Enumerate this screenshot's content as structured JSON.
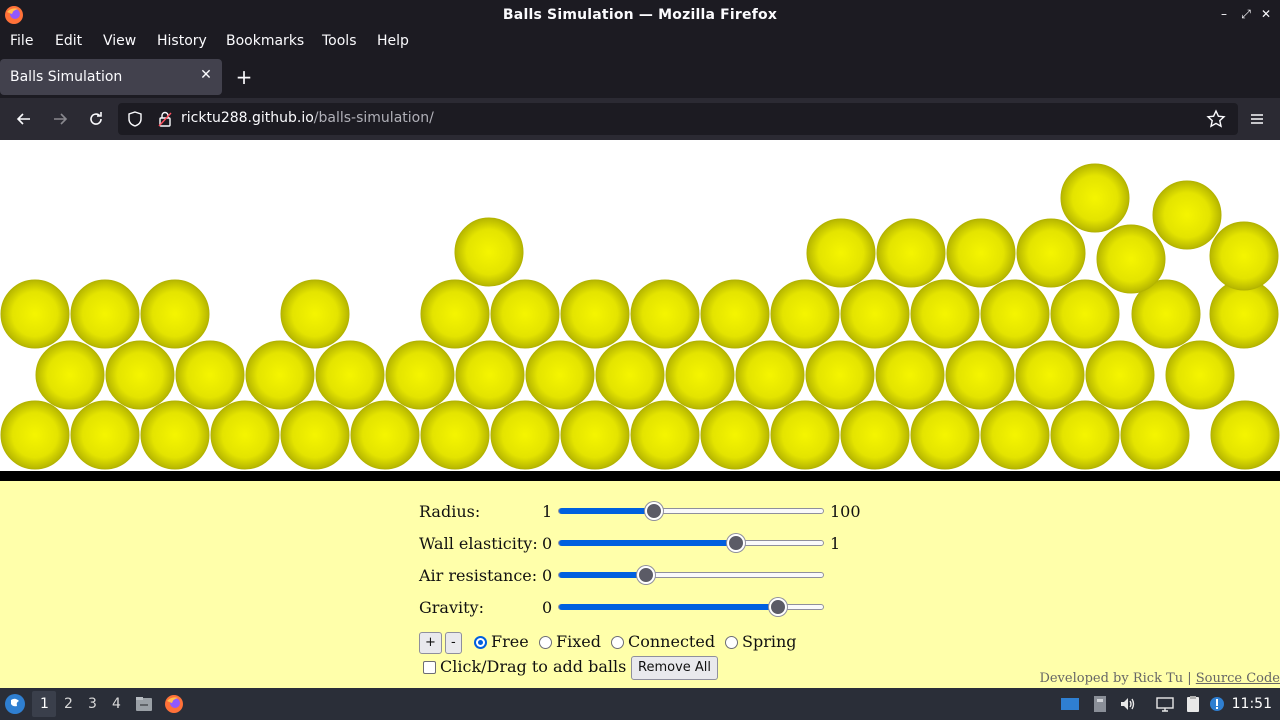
{
  "window": {
    "title": "Balls Simulation — Mozilla Firefox"
  },
  "menu": [
    "File",
    "Edit",
    "View",
    "History",
    "Bookmarks",
    "Tools",
    "Help"
  ],
  "tab": {
    "label": "Balls Simulation"
  },
  "url": {
    "host": "ricktu288.github.io",
    "path": "/balls-simulation/"
  },
  "controls": {
    "radius": {
      "label": "Radius:",
      "min": "1",
      "max": "100",
      "value_fraction": 0.36
    },
    "wall_elasticity": {
      "label": "Wall elasticity:",
      "min": "0",
      "max": "1",
      "value_fraction": 0.67
    },
    "air_resistance": {
      "label": "Air resistance:",
      "min": "0",
      "max": "",
      "value_fraction": 0.33
    },
    "gravity": {
      "label": "Gravity:",
      "min": "0",
      "max": "",
      "value_fraction": 0.83
    },
    "plus_label": "+",
    "minus_label": "-",
    "modes": [
      {
        "label": "Free",
        "checked": true
      },
      {
        "label": "Fixed",
        "checked": false
      },
      {
        "label": "Connected",
        "checked": false
      },
      {
        "label": "Spring",
        "checked": false
      }
    ],
    "add_balls_label": "Click/Drag to add balls",
    "remove_all_label": "Remove All"
  },
  "credit": {
    "text": "Developed by Rick Tu",
    "separator": " | ",
    "link": "Source Code"
  },
  "taskbar": {
    "workspaces": [
      "1",
      "2",
      "3",
      "4"
    ],
    "clock": "11:51"
  },
  "colors": {
    "ball": "#e8e800",
    "panel": "#ffffaa",
    "accent": "#0060df"
  }
}
